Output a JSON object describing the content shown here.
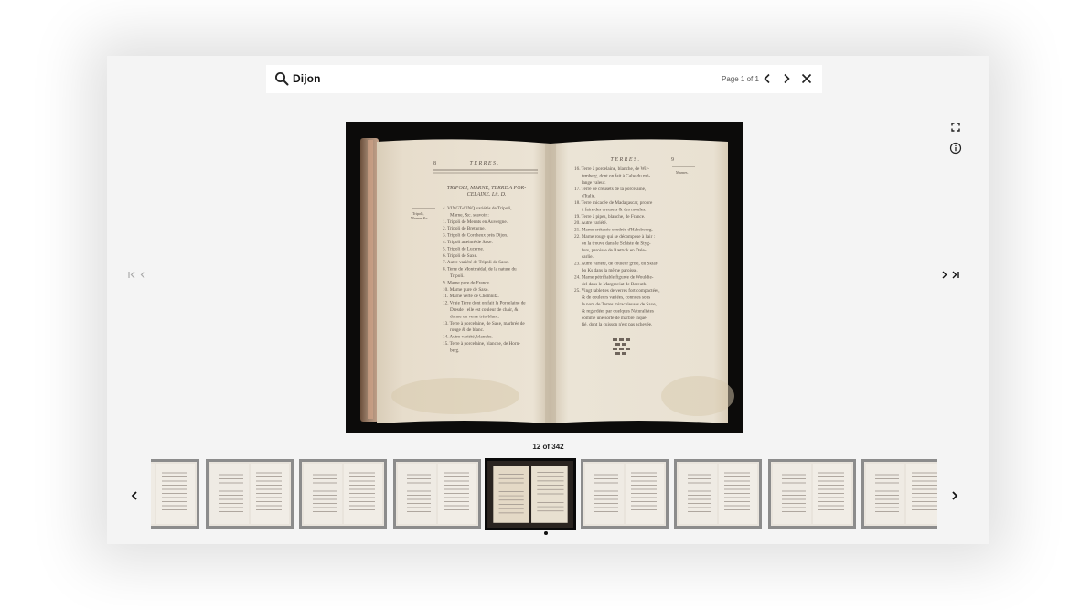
{
  "search": {
    "query": "Dijon",
    "page_count": "Page 1 of 1"
  },
  "book_page": {
    "left": {
      "header_num": "8",
      "header_title": "TERRES.",
      "heading_line1": "TRIPOLI, MARNE, TERRE A POR-",
      "heading_line2": "CELAINE. Lit. D.",
      "margin_note1": "Tripoli,",
      "margin_note2": "Marnes &c.",
      "lines": [
        "4. VINGT-CINQ variétés de Tripoli,",
        "Marne, &c. sçavoir :",
        "1. Tripoli de Menats en Auvergne.",
        "2. Tripoli de Bretagne.",
        "3. Tripoli de Corcheux près Dijon.",
        "4. Tripoli atteinté de Saxe.",
        "5. Tripoli de Lucerne.",
        "6. Tripoli de Saxe.",
        "7. Autre variété de Tripoli de Saxe.",
        "8. Terre de Montmédal, de la nature du",
        "Tripoli.",
        "9. Marne pure de France.",
        "10. Marne pure de Saxe.",
        "11. Marne verte de Chemnitz.",
        "12. Vraie Terre dont on fait la Porcelaine de",
        "Dresde ; elle est couleur de chair, &",
        "donne un verre très-blanc.",
        "13. Terre à porcelaine, de Saxe, marbrée de",
        "rouge & de blanc.",
        "14. Autre variété, blanche.",
        "15. Terre à porcelaine, blanche, de Horn-",
        "berg."
      ]
    },
    "right": {
      "header_title": "TERRES.",
      "header_num": "9",
      "margin_note": "Marnes.",
      "lines": [
        "16. Terre à porcelaine, blanche, de Wir-",
        "temberg, dont on fait à Calw du mé-",
        "lange valeur.",
        "17. Terre de creusets de la porcelaine,",
        "d'Italie.",
        "18. Terre micacée de Madagascar, propre",
        "à faire des creusets & des moules.",
        "19. Terre à pipes, blanche, de France.",
        "20. Autre variété.",
        "21. Marne crétacée cendrée d'Habsbourg.",
        "22. Marne rouge qui se décompose à l'air :",
        "on la trouve dans le Schiste de Styg-",
        "fors, paroisse de Rættvik en Dale-",
        "carlie.",
        "23. Autre variété, de couleur grise, du Skiär-",
        "bo Ks dans la même paroisse.",
        "24. Marne pétrifiable figurée de Wouldie-",
        "del dans le Margraviat de Bareuth.",
        "25. Vingt tablettes de verres fort compactées,",
        "& de couleurs variées, connues sous",
        "le nom de Terres miraculeuses de Saxe,",
        "& regardées par quelques Naturalistes",
        "comme une sorte de marbre inqué-",
        "fié, dont la cuisson n'est pas achevée."
      ]
    }
  },
  "navigation": {
    "page_counter": "12 of 342",
    "current_index": 12,
    "total_pages": 342
  },
  "thumbnails": [
    {
      "label": "page-8"
    },
    {
      "label": "page-9"
    },
    {
      "label": "page-10"
    },
    {
      "label": "page-11"
    },
    {
      "label": "page-12",
      "active": true
    },
    {
      "label": "page-13"
    },
    {
      "label": "page-14"
    },
    {
      "label": "page-15"
    },
    {
      "label": "page-16"
    }
  ],
  "icons": {
    "search": "search-icon",
    "prev_match": "chevron-left-icon",
    "next_match": "chevron-right-icon",
    "close": "close-icon",
    "fullscreen": "fullscreen-icon",
    "info": "info-icon",
    "first_page": "first-page-icon",
    "prev_page": "chevron-left-icon",
    "next_page": "chevron-right-icon",
    "last_page": "last-page-icon"
  },
  "colors": {
    "panel_bg": "#f4f4f4",
    "image_bg": "#0c0b0a",
    "paper": "#e6dccb",
    "ink": "#5a5048",
    "thumb_border": "#8c8c8c",
    "thumb_active_border": "#0a0a0a"
  }
}
